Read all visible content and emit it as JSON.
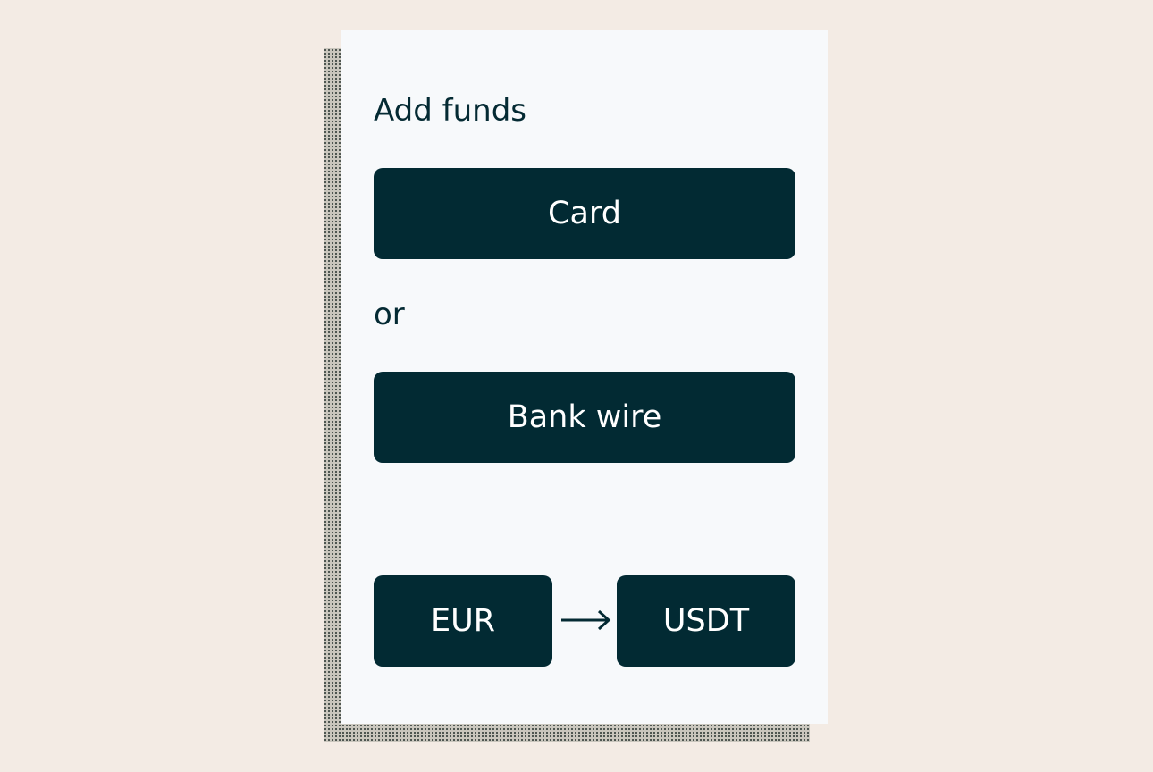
{
  "panel": {
    "title": "Add funds",
    "card_button_label": "Card",
    "separator_text": "or",
    "bank_wire_button_label": "Bank wire",
    "conversion": {
      "from_label": "EUR",
      "to_label": "USDT",
      "arrow_icon": "right-arrow-icon"
    }
  },
  "colors": {
    "background": "#f3ebe4",
    "panel": "#f7f9fb",
    "button": "#022a33",
    "text": "#042a33"
  }
}
